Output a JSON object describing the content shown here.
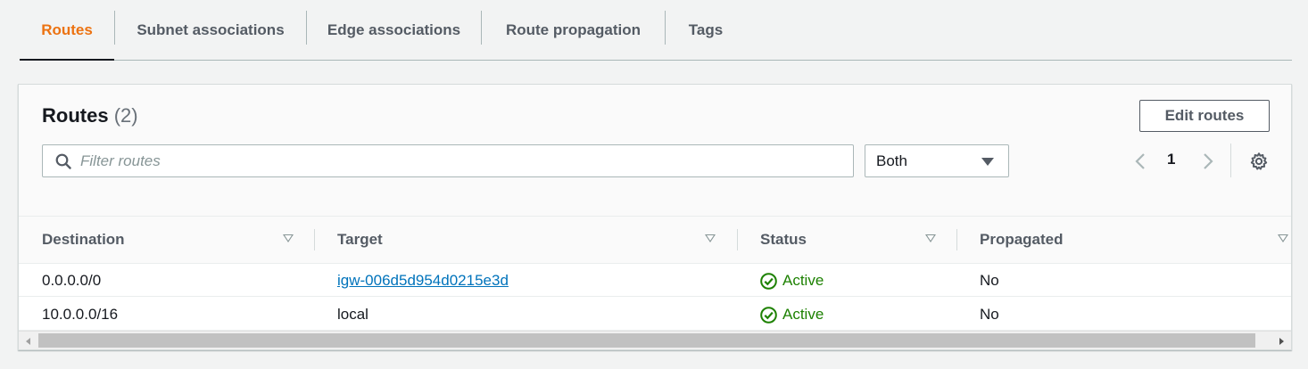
{
  "tabs": [
    {
      "label": "Routes",
      "active": true
    },
    {
      "label": "Subnet associations",
      "active": false
    },
    {
      "label": "Edge associations",
      "active": false
    },
    {
      "label": "Route propagation",
      "active": false
    },
    {
      "label": "Tags",
      "active": false
    }
  ],
  "panel": {
    "title": "Routes",
    "count": "(2)",
    "edit_button": "Edit routes",
    "search_placeholder": "Filter routes",
    "search_value": "",
    "filter_select": "Both",
    "page": "1",
    "icons": {
      "search": "search-icon",
      "settings": "gear-icon",
      "prev": "chevron-left-icon",
      "next": "chevron-right-icon"
    }
  },
  "table": {
    "columns": [
      "Destination",
      "Target",
      "Status",
      "Propagated"
    ],
    "rows": [
      {
        "destination": "0.0.0.0/0",
        "target": "igw-006d5d954d0215e3d",
        "target_is_link": true,
        "status": "Active",
        "propagated": "No"
      },
      {
        "destination": "10.0.0.0/16",
        "target": "local",
        "target_is_link": false,
        "status": "Active",
        "propagated": "No"
      }
    ]
  },
  "colors": {
    "active_tab": "#ec7211",
    "link": "#0073bb",
    "status_active": "#1d8102"
  }
}
